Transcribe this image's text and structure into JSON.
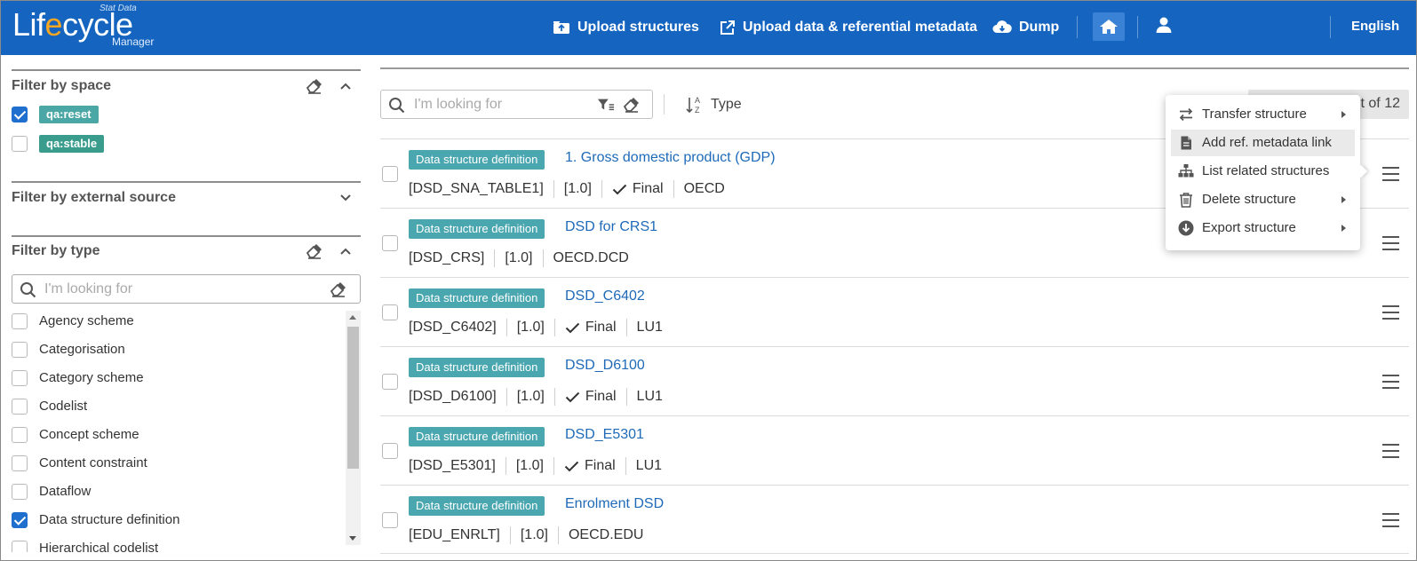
{
  "header": {
    "logo": {
      "top": "Stat Data",
      "main_prefix": "Lif",
      "main_e": "e",
      "main_suffix": "cycle",
      "bottom": "Manager"
    },
    "nav": [
      {
        "label": "Upload structures",
        "icon": "upload-structures-icon"
      },
      {
        "label": "Upload data & referential metadata",
        "icon": "external-upload-icon"
      },
      {
        "label": "Dump",
        "icon": "cloud-download-icon"
      }
    ],
    "language": "English",
    "colors": {
      "bar": "#1565c0",
      "home_active": "#3a82d6"
    }
  },
  "filters": {
    "space": {
      "title": "Filter by space",
      "items": [
        {
          "label": "qa:reset",
          "checked": true
        },
        {
          "label": "qa:stable",
          "checked": false
        }
      ]
    },
    "external_source": {
      "title": "Filter by external source"
    },
    "type": {
      "title": "Filter by type",
      "search_placeholder": "I'm looking for",
      "items": [
        {
          "label": "Agency scheme",
          "checked": false
        },
        {
          "label": "Categorisation",
          "checked": false
        },
        {
          "label": "Category scheme",
          "checked": false
        },
        {
          "label": "Codelist",
          "checked": false
        },
        {
          "label": "Concept scheme",
          "checked": false
        },
        {
          "label": "Content constraint",
          "checked": false
        },
        {
          "label": "Dataflow",
          "checked": false
        },
        {
          "label": "Data structure definition",
          "checked": true
        },
        {
          "label": "Hierarchical codelist",
          "checked": false
        }
      ]
    }
  },
  "toolbar": {
    "search_placeholder": "I'm looking for",
    "sort_label": "Type",
    "pager": "1 - 6 out of 12",
    "pager_visible": "t of 12"
  },
  "rows": [
    {
      "badge": "Data structure definition",
      "title": "1. Gross domestic product (GDP)",
      "id": "[DSD_SNA_TABLE1]",
      "version": "[1.0]",
      "final": "Final",
      "agency": "OECD"
    },
    {
      "badge": "Data structure definition",
      "title": "DSD for CRS1",
      "id": "[DSD_CRS]",
      "version": "[1.0]",
      "final": "",
      "agency": "OECD.DCD"
    },
    {
      "badge": "Data structure definition",
      "title": "DSD_C6402",
      "id": "[DSD_C6402]",
      "version": "[1.0]",
      "final": "Final",
      "agency": "LU1"
    },
    {
      "badge": "Data structure definition",
      "title": "DSD_D6100",
      "id": "[DSD_D6100]",
      "version": "[1.0]",
      "final": "Final",
      "agency": "LU1"
    },
    {
      "badge": "Data structure definition",
      "title": "DSD_E5301",
      "id": "[DSD_E5301]",
      "version": "[1.0]",
      "final": "Final",
      "agency": "LU1"
    },
    {
      "badge": "Data structure definition",
      "title": "Enrolment DSD",
      "id": "[EDU_ENRLT]",
      "version": "[1.0]",
      "final": "",
      "agency": "OECD.EDU"
    }
  ],
  "context_menu": {
    "items": [
      {
        "label": "Transfer structure",
        "icon": "transfer-icon",
        "submenu": true,
        "highlighted": false
      },
      {
        "label": "Add ref. metadata link",
        "icon": "document-icon",
        "submenu": false,
        "highlighted": true
      },
      {
        "label": "List related structures",
        "icon": "hierarchy-icon",
        "submenu": false,
        "highlighted": false
      },
      {
        "label": "Delete structure",
        "icon": "trash-icon",
        "submenu": true,
        "highlighted": false
      },
      {
        "label": "Export structure",
        "icon": "download-circle-icon",
        "submenu": true,
        "highlighted": false
      }
    ]
  }
}
